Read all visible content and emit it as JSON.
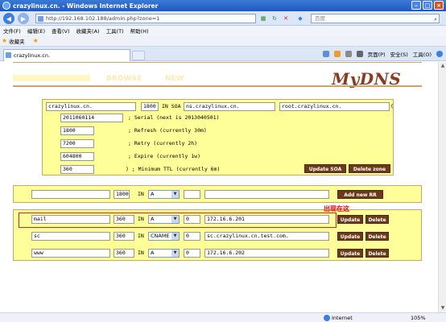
{
  "window": {
    "title": "crazylinux.cn. - Windows Internet Explorer"
  },
  "address": {
    "url": "http://192.168.102.188/admin.php?zone=1",
    "search_placeholder": "百度"
  },
  "menus": [
    "文件(F)",
    "编辑(E)",
    "查看(V)",
    "收藏夹(A)",
    "工具(T)",
    "帮助(H)"
  ],
  "favorites": {
    "label": "收藏夹"
  },
  "tab": {
    "label": "crazylinux.cn."
  },
  "commands": {
    "page": "页面(P)",
    "safety": "安全(S)",
    "tools": "工具(O)"
  },
  "status": {
    "zone": "Internet",
    "zoom": "105%"
  },
  "app": {
    "nav": {
      "browse": "BROWSE",
      "new": "NEW"
    },
    "logo": "MyDNS"
  },
  "soa": {
    "origin": "crazylinux.cn.",
    "ttl": "1800",
    "in_soa": "IN SOA",
    "ns": "ns.crazylinux.cn.",
    "mbox": "root.crazylinux.cn.",
    "open_paren": "(",
    "serial": "2011060114",
    "serial_label": "; Serial (next is 2013040501)",
    "refresh": "1800",
    "refresh_label": "; Refresh (currently 30m)",
    "retry": "7200",
    "retry_label": "; Retry (currently 2h)",
    "expire": "604800",
    "expire_label": "; Expire (currently 1w)",
    "minimum": "360",
    "minimum_label": ") ; Minimum TTL (currently 6m)",
    "update_button": "Update SOA",
    "delete_button": "Delete zone"
  },
  "new_rr": {
    "name": "",
    "ttl": "1800",
    "class": "IN",
    "type": "A",
    "aux": "",
    "data": "",
    "add_button": "Add new RR"
  },
  "records": [
    {
      "name": "mail",
      "ttl": "360",
      "class": "IN",
      "type": "A",
      "aux": "0",
      "data": "172.16.6.201",
      "update": "Update",
      "delete": "Delete"
    },
    {
      "name": "sc",
      "ttl": "360",
      "class": "IN",
      "type": "CNAME",
      "aux": "0",
      "data": "sc.crazylinux.cn.test.com.",
      "update": "Update",
      "delete": "Delete"
    },
    {
      "name": "www",
      "ttl": "360",
      "class": "IN",
      "type": "A",
      "aux": "0",
      "data": "172.16.6.202",
      "update": "Update",
      "delete": "Delete"
    }
  ],
  "annotation": {
    "text": "出现在这"
  },
  "colors": {
    "panel": "#ffff99",
    "button": "#6b3a1a",
    "logo": "#8b3a1f",
    "highlight": "#dd2222"
  }
}
